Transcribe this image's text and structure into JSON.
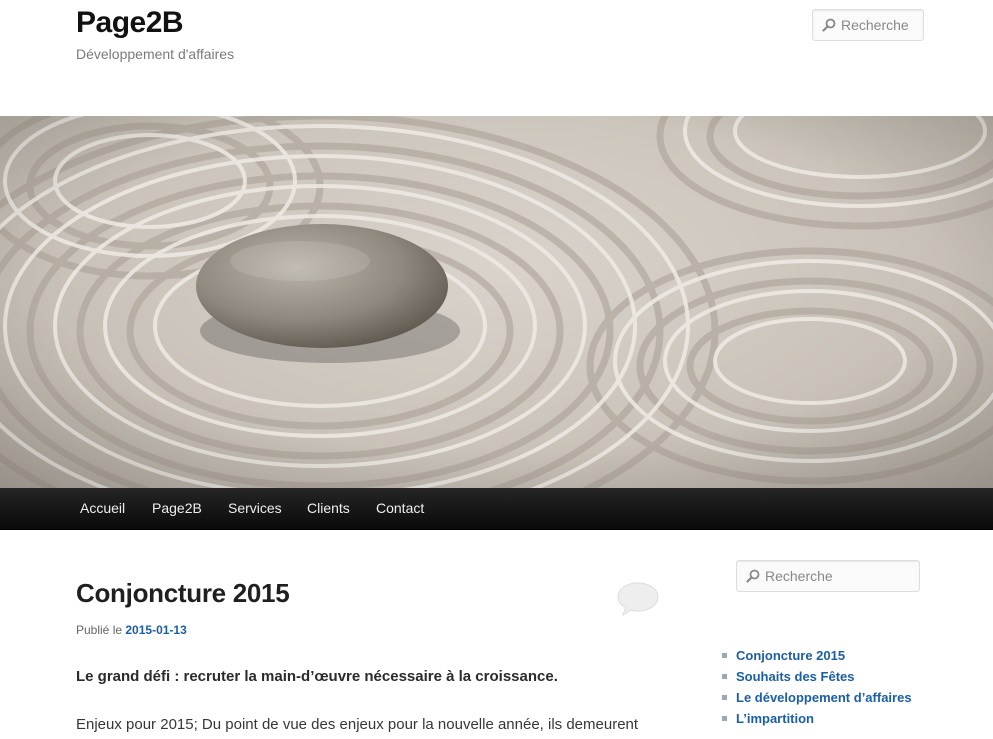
{
  "header": {
    "site_title": "Page2B",
    "site_description": "Développement d'affaires",
    "search_placeholder": "Recherche"
  },
  "nav": {
    "items": [
      {
        "label": "Accueil"
      },
      {
        "label": "Page2B"
      },
      {
        "label": "Services"
      },
      {
        "label": "Clients"
      },
      {
        "label": "Contact"
      }
    ]
  },
  "article": {
    "title": "Conjoncture 2015",
    "meta_prefix": "Publié le",
    "date": "2015-01-13",
    "lead": "Le grand défi : recruter la main-d’œuvre nécessaire à la croissance.",
    "body": "Enjeux pour 2015; Du point de vue des enjeux pour la nouvelle année, ils demeurent"
  },
  "sidebar": {
    "search_placeholder": "Recherche",
    "recent_posts": [
      {
        "label": "Conjoncture 2015"
      },
      {
        "label": "Souhaits des Fêtes"
      },
      {
        "label": "Le développement d’affaires"
      },
      {
        "label": "L’impartition"
      }
    ]
  },
  "icons": {
    "search": "search-icon",
    "comment": "comment-bubble-icon"
  },
  "colors": {
    "link": "#1b5fa3",
    "nav_background": "#1b1b1b",
    "nav_text": "#eeeeee"
  }
}
